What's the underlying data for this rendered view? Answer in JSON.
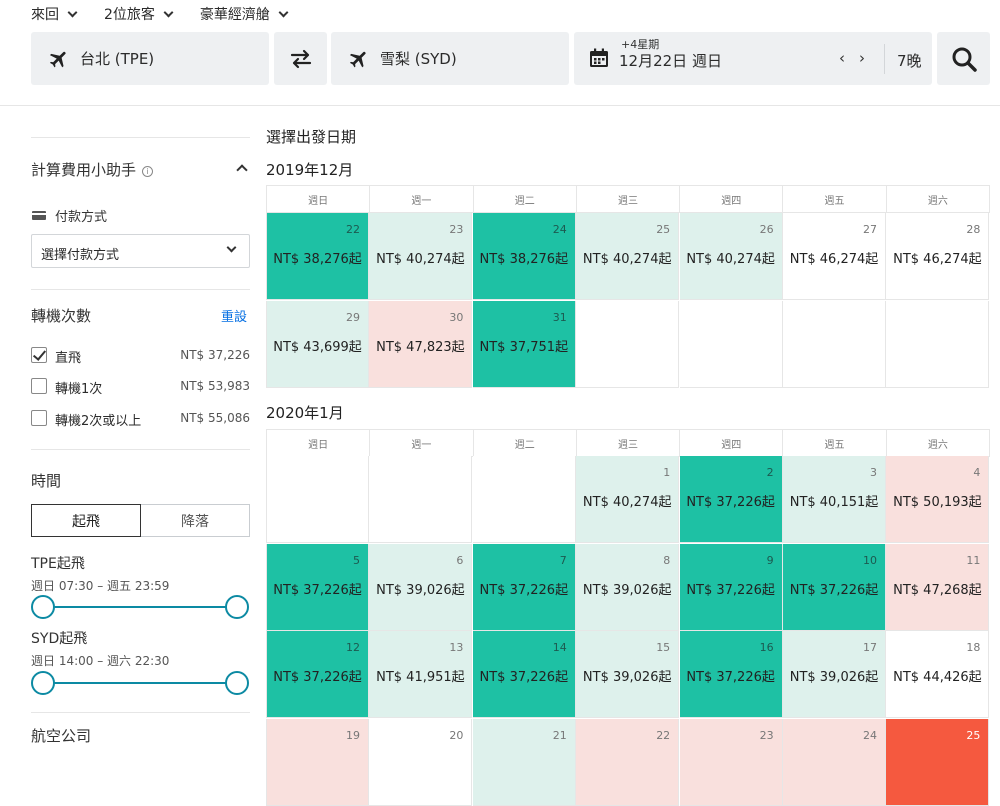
{
  "topbar": {
    "options": [
      {
        "label": "來回"
      },
      {
        "label": "2位旅客"
      },
      {
        "label": "豪華經濟艙"
      }
    ],
    "origin": "台北 (TPE)",
    "destination": "雪梨 (SYD)",
    "date_offset": "+4星期",
    "date": "12月22日 週日",
    "prev_arrow": "‹",
    "next_arrow": "›",
    "nights": "7晚"
  },
  "sidebar": {
    "calculator_title": "計算費用小助手",
    "info_glyph": "i",
    "payment_label": "付款方式",
    "payment_select": "選擇付款方式",
    "stops_title": "轉機次數",
    "reset": "重設",
    "stops": [
      {
        "label": "直飛",
        "price": "NT$ 37,226",
        "checked": true
      },
      {
        "label": "轉機1次",
        "price": "NT$ 53,983",
        "checked": false
      },
      {
        "label": "轉機2次或以上",
        "price": "NT$ 55,086",
        "checked": false
      }
    ],
    "time_title": "時間",
    "tab_depart": "起飛",
    "tab_arrive": "降落",
    "tpe_title": "TPE起飛",
    "tpe_range": "週日 07:30 – 週五 23:59",
    "syd_title": "SYD起飛",
    "syd_range": "週日 14:00 – 週六 22:30",
    "airlines_title": "航空公司"
  },
  "calendar": {
    "heading": "選擇出發日期",
    "weekdays": [
      "週日",
      "週一",
      "週二",
      "週三",
      "週四",
      "週五",
      "週六"
    ],
    "months": [
      {
        "title": "2019年12月",
        "cells": [
          {
            "day": "22",
            "price": "NT$ 38,276起",
            "tone": "teal"
          },
          {
            "day": "23",
            "price": "NT$ 40,274起",
            "tone": "mint"
          },
          {
            "day": "24",
            "price": "NT$ 38,276起",
            "tone": "teal"
          },
          {
            "day": "25",
            "price": "NT$ 40,274起",
            "tone": "mint"
          },
          {
            "day": "26",
            "price": "NT$ 40,274起",
            "tone": "mint"
          },
          {
            "day": "27",
            "price": "NT$ 46,274起",
            "tone": "white"
          },
          {
            "day": "28",
            "price": "NT$ 46,274起",
            "tone": "white"
          },
          {
            "day": "29",
            "price": "NT$ 43,699起",
            "tone": "mint"
          },
          {
            "day": "30",
            "price": "NT$ 47,823起",
            "tone": "pink"
          },
          {
            "day": "31",
            "price": "NT$ 37,751起",
            "tone": "teal"
          },
          {
            "day": "",
            "price": "",
            "tone": "empty"
          },
          {
            "day": "",
            "price": "",
            "tone": "empty"
          },
          {
            "day": "",
            "price": "",
            "tone": "empty"
          },
          {
            "day": "",
            "price": "",
            "tone": "empty"
          }
        ]
      },
      {
        "title": "2020年1月",
        "cells": [
          {
            "day": "",
            "price": "",
            "tone": "empty"
          },
          {
            "day": "",
            "price": "",
            "tone": "empty"
          },
          {
            "day": "",
            "price": "",
            "tone": "empty"
          },
          {
            "day": "1",
            "price": "NT$ 40,274起",
            "tone": "mint"
          },
          {
            "day": "2",
            "price": "NT$ 37,226起",
            "tone": "teal"
          },
          {
            "day": "3",
            "price": "NT$ 40,151起",
            "tone": "mint"
          },
          {
            "day": "4",
            "price": "NT$ 50,193起",
            "tone": "pink"
          },
          {
            "day": "5",
            "price": "NT$ 37,226起",
            "tone": "teal"
          },
          {
            "day": "6",
            "price": "NT$ 39,026起",
            "tone": "mint"
          },
          {
            "day": "7",
            "price": "NT$ 37,226起",
            "tone": "teal"
          },
          {
            "day": "8",
            "price": "NT$ 39,026起",
            "tone": "mint"
          },
          {
            "day": "9",
            "price": "NT$ 37,226起",
            "tone": "teal"
          },
          {
            "day": "10",
            "price": "NT$ 37,226起",
            "tone": "teal"
          },
          {
            "day": "11",
            "price": "NT$ 47,268起",
            "tone": "pink"
          },
          {
            "day": "12",
            "price": "NT$ 37,226起",
            "tone": "teal"
          },
          {
            "day": "13",
            "price": "NT$ 41,951起",
            "tone": "mint"
          },
          {
            "day": "14",
            "price": "NT$ 37,226起",
            "tone": "teal"
          },
          {
            "day": "15",
            "price": "NT$ 39,026起",
            "tone": "mint"
          },
          {
            "day": "16",
            "price": "NT$ 37,226起",
            "tone": "teal"
          },
          {
            "day": "17",
            "price": "NT$ 39,026起",
            "tone": "mint"
          },
          {
            "day": "18",
            "price": "NT$ 44,426起",
            "tone": "white"
          },
          {
            "day": "19",
            "price": "",
            "tone": "pink"
          },
          {
            "day": "20",
            "price": "",
            "tone": "white"
          },
          {
            "day": "21",
            "price": "",
            "tone": "mint"
          },
          {
            "day": "22",
            "price": "",
            "tone": "pink"
          },
          {
            "day": "23",
            "price": "",
            "tone": "pink"
          },
          {
            "day": "24",
            "price": "",
            "tone": "pink"
          },
          {
            "day": "25",
            "price": "",
            "tone": "red"
          }
        ]
      }
    ]
  },
  "colors": {
    "teal": "#1ec1a4",
    "mint": "#def1ec",
    "pink": "#f9e0dd",
    "red": "#f5593f",
    "slider": "#0c8aa3",
    "link": "#0770e3"
  }
}
